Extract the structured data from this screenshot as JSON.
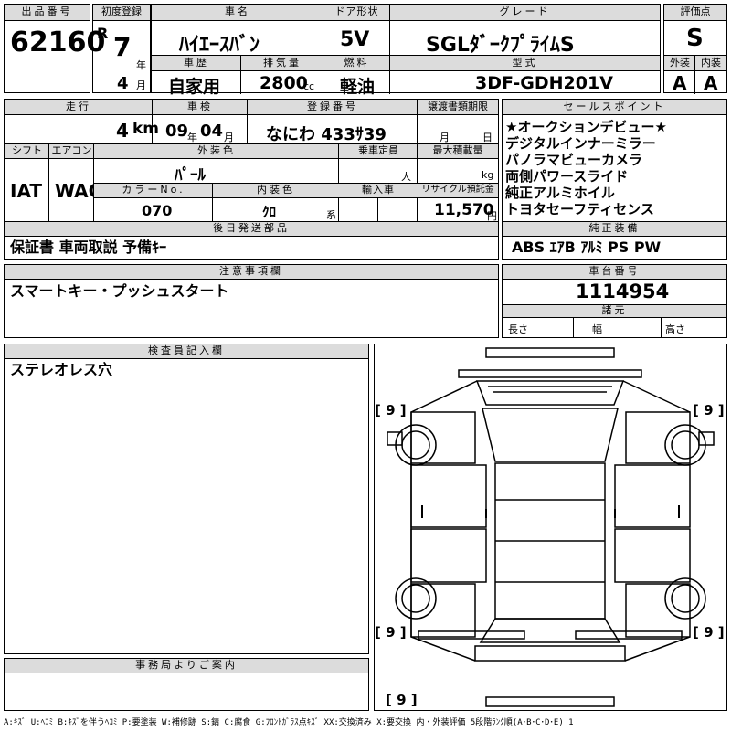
{
  "lot": {
    "label": "出品番号",
    "value": "62160"
  },
  "first_reg": {
    "label": "初度登録",
    "era": "R",
    "year": "7",
    "year_unit": "年",
    "month": "4",
    "month_unit": "月"
  },
  "car_name": {
    "label": "車名",
    "value": "ﾊｲｴｰｽﾊﾞﾝ"
  },
  "door": {
    "label": "ドア形状",
    "value": "5V"
  },
  "grade": {
    "label": "グレード",
    "value": "SGLﾀﾞｰｸﾌﾟﾗｲﾑS"
  },
  "rating": {
    "label": "評価点",
    "value": "S"
  },
  "history": {
    "label": "車歴",
    "value": "自家用"
  },
  "displacement": {
    "label": "排気量",
    "value": "2800",
    "unit": "cc"
  },
  "fuel": {
    "label": "燃料",
    "value": "軽油"
  },
  "model": {
    "label": "型式",
    "value": "3DF-GDH201V"
  },
  "exterior": {
    "label": "外装",
    "value": "A"
  },
  "interior": {
    "label": "内装",
    "value": "A"
  },
  "mileage": {
    "label": "走行",
    "value": "4",
    "unit": "km"
  },
  "inspection": {
    "label": "車検",
    "year": "09",
    "year_unit": "年",
    "month": "04",
    "month_unit": "月"
  },
  "registration": {
    "label": "登録番号",
    "value": "なにわ 433ｻ39"
  },
  "transfer": {
    "label": "譲渡書類期限",
    "month_unit": "月",
    "day_unit": "日"
  },
  "shift": {
    "label": "シフト",
    "value": "IAT"
  },
  "aircon": {
    "label": "エアコン",
    "value": "WAC"
  },
  "ext_color": {
    "label": "外装色",
    "value": "ﾊﾟｰﾙ"
  },
  "capacity": {
    "label": "乗車定員",
    "unit": "人"
  },
  "max_load": {
    "label": "最大積載量",
    "unit": "kg"
  },
  "color_no": {
    "label": "カラーNo.",
    "value": "070"
  },
  "int_color": {
    "label": "内装色",
    "value": "ｸﾛ",
    "unit": "系"
  },
  "import": {
    "label": "輸入車"
  },
  "recycle": {
    "label": "リサイクル預託金",
    "value": "11,570",
    "unit": "円"
  },
  "sales_points": {
    "label": "セールスポイント",
    "items": [
      "★オークションデビュー★",
      "デジタルインナーミラー",
      "パノラマビューカメラ",
      "両側パワースライド",
      "純正アルミホイル",
      "トヨタセーフティセンス"
    ]
  },
  "later_parts": {
    "label": "後日発送部品",
    "value": "保証書 車両取説 予備ｷｰ"
  },
  "equipment": {
    "label": "純正装備",
    "value": "ABS ｴｱB ｱﾙﾐ PS PW"
  },
  "notes": {
    "label": "注意事項欄",
    "value": "スマートキー・プッシュスタート"
  },
  "chassis": {
    "label": "車台番号",
    "value": "1114954"
  },
  "specs": {
    "label": "諸元",
    "length": "長さ",
    "width": "幅",
    "height": "高さ"
  },
  "inspector": {
    "label": "検査員記入欄",
    "value": "ステレオレス穴"
  },
  "office": {
    "label": "事務局よりご案内"
  },
  "diagram": {
    "glass_marks": [
      "[ 9 ]",
      "[ 9 ]",
      "[ 9 ]",
      "[ 9 ]",
      "[ 9 ]"
    ]
  },
  "legend": "A:ｷｽﾞ U:ﾍｺﾐ B:ｷｽﾞを伴うﾍｺﾐ P:要塗装 W:補修跡 S:錆 C:腐食 G:ﾌﾛﾝﾄｶﾞﾗｽ点ｷｽﾞ XX:交換済み X:要交換 内・外装評価 5段階ﾗﾝｸ順(A･B･C･D･E) 1"
}
